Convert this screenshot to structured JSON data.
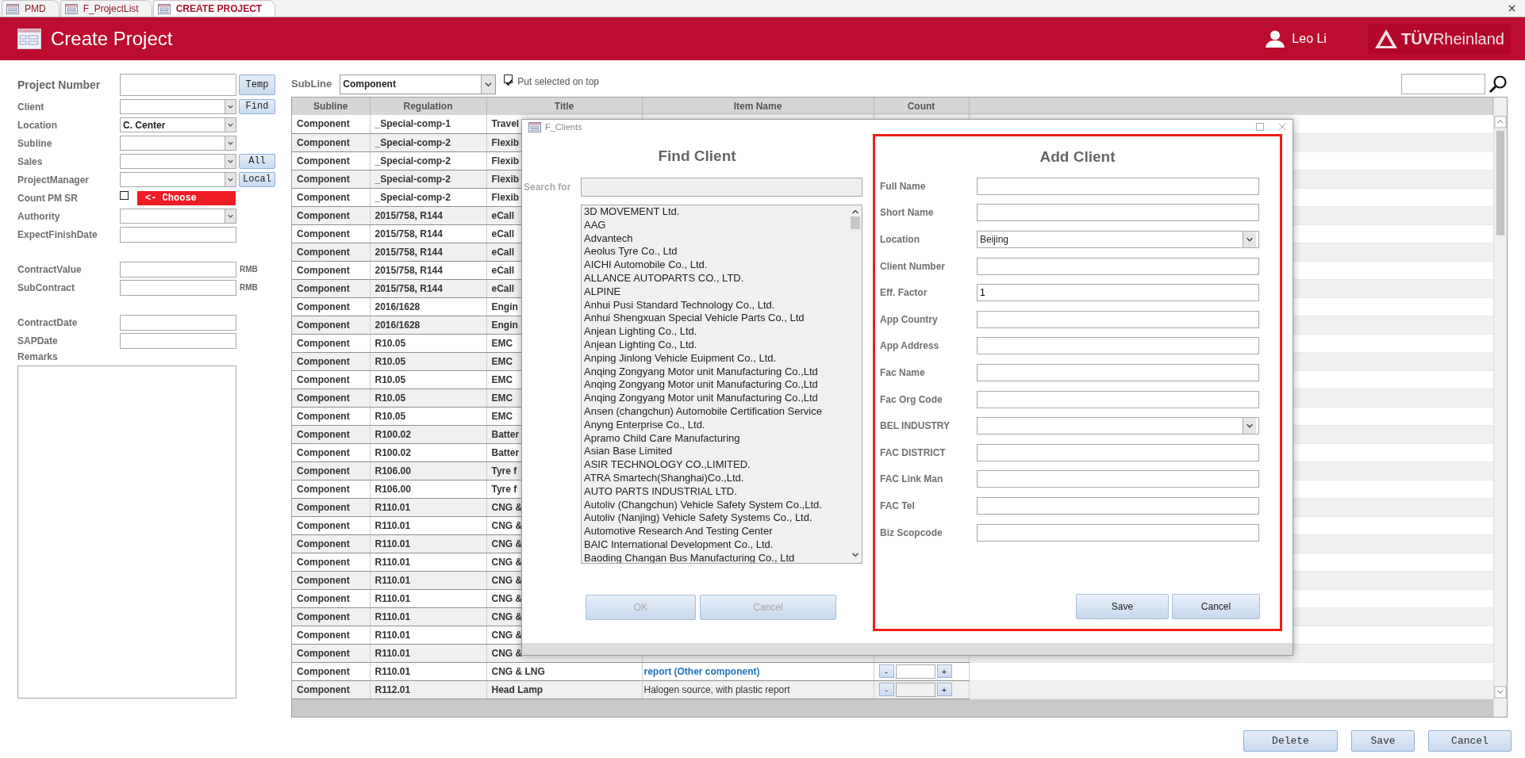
{
  "tabs": [
    {
      "label": "PMD",
      "selected": false
    },
    {
      "label": "F_ProjectList",
      "selected": false
    },
    {
      "label": "CREATE PROJECT",
      "selected": true
    }
  ],
  "header": {
    "title": "Create Project",
    "user": "Leo Li",
    "logo": "**TÜV**Rheinland"
  },
  "form": {
    "groups": [
      [
        {
          "label": "Project Number",
          "kind": "text",
          "button": "Temp"
        },
        {
          "label": "Client",
          "kind": "select",
          "button": "Find"
        },
        {
          "label": "Location",
          "kind": "select",
          "value": "C. Center"
        },
        {
          "label": "Subline",
          "kind": "select"
        },
        {
          "label": "Sales",
          "kind": "select",
          "button": "All"
        },
        {
          "label": "ProjectManager",
          "kind": "select",
          "button": "Local"
        },
        {
          "label": "Count PM SR",
          "kind": "checkbox",
          "checked": false,
          "note": "<- Choose"
        },
        {
          "label": "Authority",
          "kind": "select"
        },
        {
          "label": "ExpectFinishDate",
          "kind": "text"
        }
      ],
      [
        {
          "label": "ContractValue",
          "kind": "text",
          "unit": "RMB"
        },
        {
          "label": "SubContract",
          "kind": "text",
          "unit": "RMB"
        }
      ],
      [
        {
          "label": "ContractDate",
          "kind": "text"
        },
        {
          "label": "SAPDate",
          "kind": "text"
        },
        {
          "label": "Remarks",
          "kind": "textarea"
        }
      ]
    ]
  },
  "table": {
    "filter": {
      "label": "SubLine",
      "value": "Component"
    },
    "put_on_top": {
      "label": "Put selected on top",
      "checked": true
    },
    "columns": [
      "Subline",
      "Regulation",
      "Title",
      "Item Name",
      "Count"
    ],
    "rows": [
      {
        "subline": "Component",
        "regulation": "_Special-comp-1",
        "title": "Travel"
      },
      {
        "subline": "Component",
        "regulation": "_Special-comp-2",
        "title": "Flexib"
      },
      {
        "subline": "Component",
        "regulation": "_Special-comp-2",
        "title": "Flexib"
      },
      {
        "subline": "Component",
        "regulation": "_Special-comp-2",
        "title": "Flexib"
      },
      {
        "subline": "Component",
        "regulation": "_Special-comp-2",
        "title": "Flexib"
      },
      {
        "subline": "Component",
        "regulation": "2015/758, R144",
        "title": "eCall"
      },
      {
        "subline": "Component",
        "regulation": "2015/758, R144",
        "title": "eCall"
      },
      {
        "subline": "Component",
        "regulation": "2015/758, R144",
        "title": "eCall"
      },
      {
        "subline": "Component",
        "regulation": "2015/758, R144",
        "title": "eCall"
      },
      {
        "subline": "Component",
        "regulation": "2015/758, R144",
        "title": "eCall"
      },
      {
        "subline": "Component",
        "regulation": "2016/1628",
        "title": "Engin"
      },
      {
        "subline": "Component",
        "regulation": "2016/1628",
        "title": "Engin"
      },
      {
        "subline": "Component",
        "regulation": "R10.05",
        "title": "EMC"
      },
      {
        "subline": "Component",
        "regulation": "R10.05",
        "title": "EMC"
      },
      {
        "subline": "Component",
        "regulation": "R10.05",
        "title": "EMC"
      },
      {
        "subline": "Component",
        "regulation": "R10.05",
        "title": "EMC"
      },
      {
        "subline": "Component",
        "regulation": "R10.05",
        "title": "EMC"
      },
      {
        "subline": "Component",
        "regulation": "R100.02",
        "title": "Batter"
      },
      {
        "subline": "Component",
        "regulation": "R100.02",
        "title": "Batter"
      },
      {
        "subline": "Component",
        "regulation": "R106.00",
        "title": "Tyre f"
      },
      {
        "subline": "Component",
        "regulation": "R106.00",
        "title": "Tyre f"
      },
      {
        "subline": "Component",
        "regulation": "R110.01",
        "title": "CNG &"
      },
      {
        "subline": "Component",
        "regulation": "R110.01",
        "title": "CNG &"
      },
      {
        "subline": "Component",
        "regulation": "R110.01",
        "title": "CNG &"
      },
      {
        "subline": "Component",
        "regulation": "R110.01",
        "title": "CNG &"
      },
      {
        "subline": "Component",
        "regulation": "R110.01",
        "title": "CNG &"
      },
      {
        "subline": "Component",
        "regulation": "R110.01",
        "title": "CNG &"
      },
      {
        "subline": "Component",
        "regulation": "R110.01",
        "title": "CNG &"
      },
      {
        "subline": "Component",
        "regulation": "R110.01",
        "title": "CNG &"
      },
      {
        "subline": "Component",
        "regulation": "R110.01",
        "title": "CNG &"
      },
      {
        "subline": "Component",
        "regulation": "R110.01",
        "title": "CNG & LNG",
        "item_name": "report (Other component)",
        "link": true,
        "counter": {
          "decrement": "-",
          "increment": "+"
        }
      },
      {
        "subline": "Component",
        "regulation": "R112.01",
        "title": "Head Lamp",
        "item_name": "Halogen source, with plastic report",
        "link": false,
        "counter": {
          "decrement": "-",
          "increment": "+"
        }
      }
    ]
  },
  "dialog": {
    "title": "F_Clients",
    "find": {
      "title": "Find Client",
      "search_label": "Search for",
      "clients": [
        "3D MOVEMENT Ltd.",
        "AAG",
        "Advantech",
        "Aeolus Tyre Co., Ltd",
        "AICHI Automobile Co., Ltd.",
        "ALLANCE AUTOPARTS CO., LTD.",
        "ALPINE",
        "Anhui Pusi Standard Technology Co., Ltd.",
        "Anhui Shengxuan Special Vehicle Parts Co., Ltd",
        "Anjean Lighting Co., Ltd.",
        "Anjean Lighting Co., Ltd.",
        "Anping Jinlong Vehicle Euipment Co., Ltd.",
        "Anqing Zongyang Motor unit Manufacturing Co.,Ltd",
        "Anqing Zongyang Motor unit Manufacturing Co.,Ltd",
        "Anqing Zongyang Motor unit Manufacturing Co.,Ltd",
        "Ansen (changchun) Automobile Certification Service",
        "Anyng Enterprise Co., Ltd.",
        "Apramo Child Care Manufacturing",
        "Asian Base Limited",
        "ASIR TECHNOLOGY CO.,LIMITED.",
        "ATRA Smartech(Shanghai)Co.,Ltd.",
        "AUTO PARTS INDUSTRIAL LTD.",
        "Autoliv (Changchun) Vehicle Safety System Co.,Ltd.",
        "Autoliv (Nanjing) Vehicle Safety Systems Co., Ltd.",
        "Automotive Research And Testing Center",
        "BAIC International Development Co., Ltd.",
        "Baoding Changan Bus Manufacturing Co., Ltd"
      ],
      "buttons": [
        {
          "label": "OK",
          "disabled": true
        },
        {
          "label": "Cancel",
          "disabled": true
        }
      ]
    },
    "add": {
      "title": "Add Client",
      "highlighted": true,
      "fields": [
        {
          "label": "Full Name",
          "kind": "text"
        },
        {
          "label": "Short Name",
          "kind": "text"
        },
        {
          "label": "Location",
          "kind": "select",
          "value": "Beijing"
        },
        {
          "label": "Client Number",
          "kind": "text"
        },
        {
          "label": "Eff. Factor",
          "kind": "text",
          "value": "1"
        },
        {
          "label": "App Country",
          "kind": "text"
        },
        {
          "label": "App Address",
          "kind": "text"
        },
        {
          "label": "Fac Name",
          "kind": "text"
        },
        {
          "label": "Fac Org Code",
          "kind": "text"
        },
        {
          "label": "BEL INDUSTRY",
          "kind": "select"
        },
        {
          "label": "FAC DISTRICT",
          "kind": "text"
        },
        {
          "label": "FAC Link Man",
          "kind": "text"
        },
        {
          "label": "FAC Tel",
          "kind": "text"
        },
        {
          "label": "Biz Scopcode",
          "kind": "text"
        }
      ],
      "buttons": [
        "Save",
        "Cancel"
      ]
    }
  },
  "footer_buttons": [
    "Delete",
    "Save",
    "Cancel"
  ]
}
